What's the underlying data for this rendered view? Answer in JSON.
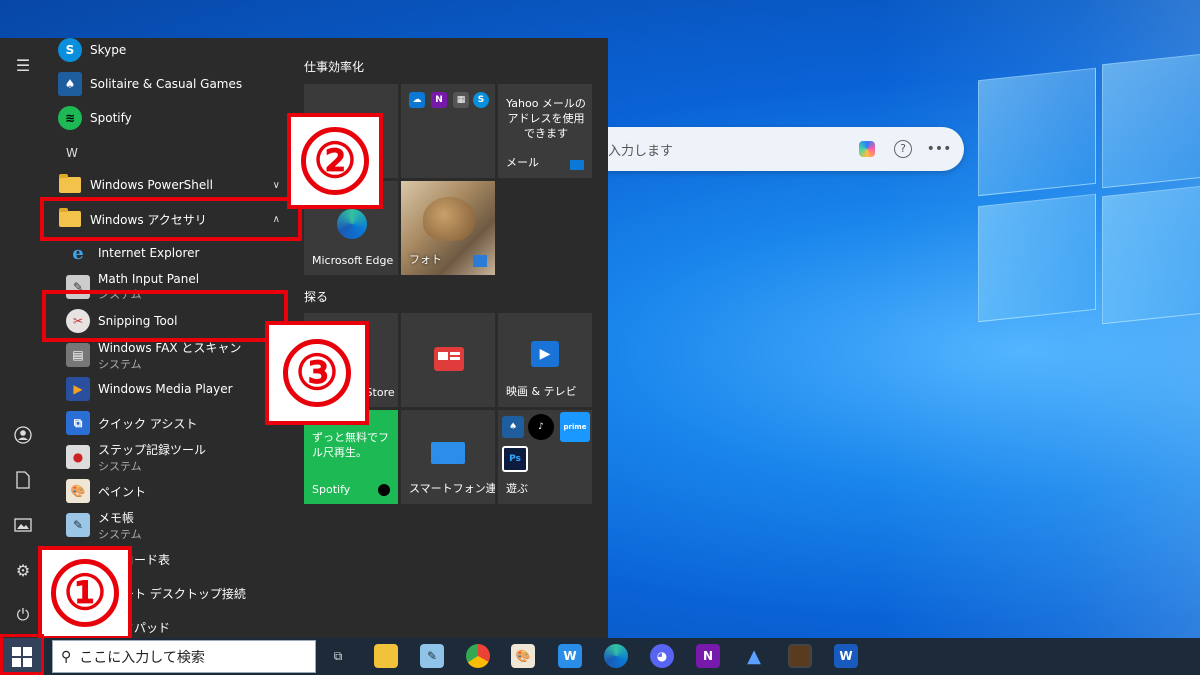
{
  "desktop": {
    "search_widget": {
      "placeholder": "入力します"
    }
  },
  "start_menu": {
    "apps": [
      {
        "name": "Skype",
        "sub": ""
      },
      {
        "name": "Solitaire & Casual Games",
        "sub": ""
      },
      {
        "name": "Spotify",
        "sub": ""
      },
      {
        "name": "Windows PowerShell",
        "sub": ""
      },
      {
        "name": "Windows アクセサリ",
        "sub": ""
      },
      {
        "name": "Internet Explorer",
        "sub": ""
      },
      {
        "name": "Math Input Panel",
        "sub": "システム"
      },
      {
        "name": "Snipping Tool",
        "sub": ""
      },
      {
        "name": "Windows FAX とスキャン",
        "sub": "システム"
      },
      {
        "name": "Windows Media Player",
        "sub": ""
      },
      {
        "name": "クイック アシスト",
        "sub": ""
      },
      {
        "name": "ステップ記録ツール",
        "sub": "システム"
      },
      {
        "name": "ペイント",
        "sub": ""
      },
      {
        "name": "メモ帳",
        "sub": "システム"
      },
      {
        "name": "文字コード表",
        "sub": ""
      },
      {
        "name": "リモート デスクトップ接続",
        "sub": ""
      },
      {
        "name": "ワードパッド",
        "sub": ""
      }
    ],
    "letter_w": "W",
    "group1_title": "仕事効率化",
    "group2_title": "探る",
    "tiles": {
      "mail_text": "Yahoo メールのアドレスを使用できます",
      "mail_label": "メール",
      "edge": "Microsoft Edge",
      "photos": "フォト",
      "store": "Microsoft Store",
      "movies": "映画 & テレビ",
      "spotify_promo": "ずっと無料でフル尺再生。",
      "spotify": "Spotify",
      "phone": "スマートフォン連携",
      "play": "遊ぶ"
    }
  },
  "annotations": {
    "one": "①",
    "two": "②",
    "three": "③"
  },
  "taskbar": {
    "search_placeholder": "ここに入力して検索"
  },
  "colors": {
    "highlight": "#e8000a",
    "spotify_green": "#1db954",
    "menu_bg": "#2b2b2b"
  }
}
